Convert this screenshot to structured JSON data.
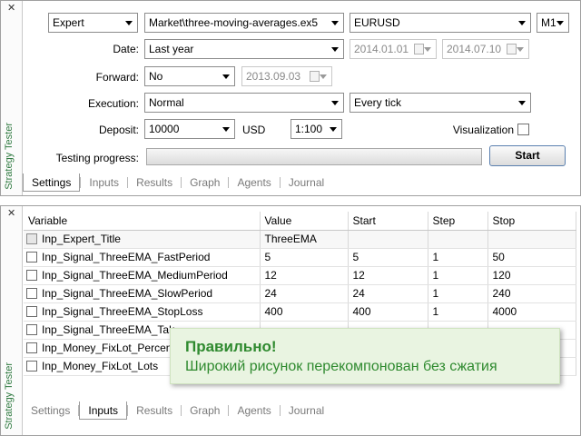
{
  "colors": {
    "accent_green": "#2f8a2f",
    "progress_green": "#3fa34d",
    "panel_title_green": "#2f7a40"
  },
  "top_panel": {
    "side_title": "Strategy Tester",
    "close_icon": "close-icon",
    "expert_type": "Expert",
    "expert_file": "Market\\three-moving-averages.ex5",
    "symbol": "EURUSD",
    "timeframe": "M1",
    "date_label": "Date:",
    "date_mode": "Last year",
    "date_from": "2014.01.01",
    "date_to": "2014.07.10",
    "forward_label": "Forward:",
    "forward_mode": "No",
    "forward_date": "2013.09.03",
    "execution_label": "Execution:",
    "execution_mode": "Normal",
    "tick_mode": "Every tick",
    "deposit_label": "Deposit:",
    "deposit_value": "10000",
    "currency": "USD",
    "leverage": "1:100",
    "visualization_label": "Visualization",
    "progress_label": "Testing progress:",
    "progress_fraction": 0,
    "start_label": "Start",
    "tabs": [
      {
        "label": "Settings",
        "active": true
      },
      {
        "label": "Inputs",
        "active": false
      },
      {
        "label": "Results",
        "active": false
      },
      {
        "label": "Graph",
        "active": false
      },
      {
        "label": "Agents",
        "active": false
      },
      {
        "label": "Journal",
        "active": false
      }
    ]
  },
  "bottom_panel": {
    "side_title": "Strategy Tester",
    "close_icon": "close-icon",
    "columns": [
      "Variable",
      "Value",
      "Start",
      "Step",
      "Stop"
    ],
    "rows": [
      {
        "variable": "Inp_Expert_Title",
        "value": "ThreeEMA",
        "start": "",
        "step": "",
        "stop": "",
        "dim": true
      },
      {
        "variable": "Inp_Signal_ThreeEMA_FastPeriod",
        "value": "5",
        "start": "5",
        "step": "1",
        "stop": "50",
        "dim": false
      },
      {
        "variable": "Inp_Signal_ThreeEMA_MediumPeriod",
        "value": "12",
        "start": "12",
        "step": "1",
        "stop": "120",
        "dim": false
      },
      {
        "variable": "Inp_Signal_ThreeEMA_SlowPeriod",
        "value": "24",
        "start": "24",
        "step": "1",
        "stop": "240",
        "dim": false
      },
      {
        "variable": "Inp_Signal_ThreeEMA_StopLoss",
        "value": "400",
        "start": "400",
        "step": "1",
        "stop": "4000",
        "dim": false
      },
      {
        "variable": "Inp_Signal_ThreeEMA_Tak",
        "value": "",
        "start": "",
        "step": "",
        "stop": "",
        "dim": false
      },
      {
        "variable": "Inp_Money_FixLot_Percent",
        "value": "",
        "start": "",
        "step": "",
        "stop": "",
        "dim": false
      },
      {
        "variable": "Inp_Money_FixLot_Lots",
        "value": "",
        "start": "",
        "step": "",
        "stop": "",
        "dim": false
      }
    ],
    "tabs": [
      {
        "label": "Settings",
        "active": false
      },
      {
        "label": "Inputs",
        "active": true
      },
      {
        "label": "Results",
        "active": false
      },
      {
        "label": "Graph",
        "active": false
      },
      {
        "label": "Agents",
        "active": false
      },
      {
        "label": "Journal",
        "active": false
      }
    ]
  },
  "toast": {
    "title": "Правильно!",
    "message": "Широкий рисунок перекомпонован без сжатия"
  }
}
